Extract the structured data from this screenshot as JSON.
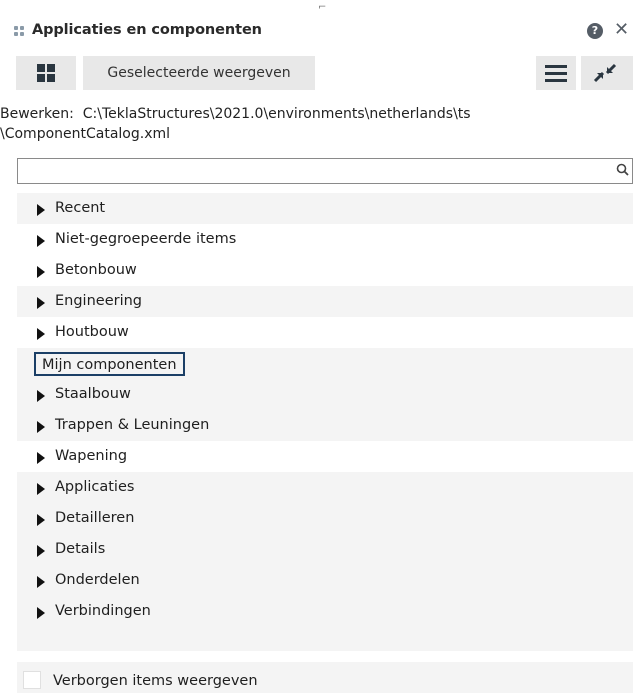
{
  "window": {
    "title": "Applicaties en componenten",
    "help_icon": "?",
    "close_icon": "✕",
    "top_mark": "⌐"
  },
  "toolbar": {
    "grid_icon": "grid-icon",
    "show_selected_label": "Geselecteerde weergeven",
    "menu_icon": "hamburger-icon",
    "collapse_icon": "collapse-arrows-icon"
  },
  "edit_path": {
    "label": "Bewerken:",
    "line1": "Bewerken:  C:\\TeklaStructures\\2021.0\\environments\\netherlands\\ts",
    "line2": "\\ComponentCatalog.xml"
  },
  "search": {
    "value": "",
    "placeholder": ""
  },
  "tree": {
    "items": [
      {
        "label": "Recent",
        "expandable": true
      },
      {
        "label": "Niet-gegroepeerde items",
        "expandable": true
      },
      {
        "label": "Betonbouw",
        "expandable": true
      },
      {
        "label": "Engineering",
        "expandable": true
      },
      {
        "label": "Houtbouw",
        "expandable": true
      },
      {
        "label": "Mijn componenten",
        "expandable": false,
        "selected": true
      },
      {
        "label": "Staalbouw",
        "expandable": true
      },
      {
        "label": "Trappen & Leuningen",
        "expandable": true
      },
      {
        "label": "Wapening",
        "expandable": true
      },
      {
        "label": "Applicaties",
        "expandable": true
      },
      {
        "label": "Detailleren",
        "expandable": true
      },
      {
        "label": "Details",
        "expandable": true
      },
      {
        "label": "Onderdelen",
        "expandable": true
      },
      {
        "label": "Verbindingen",
        "expandable": true
      }
    ]
  },
  "footer": {
    "show_hidden_label": "Verborgen items weergeven",
    "show_hidden_checked": false
  },
  "colors": {
    "selection_border": "#1b3f66",
    "tree_background": "#f4f4f4",
    "button_background": "#e8e8e8",
    "icon_dark": "#2a3640"
  }
}
